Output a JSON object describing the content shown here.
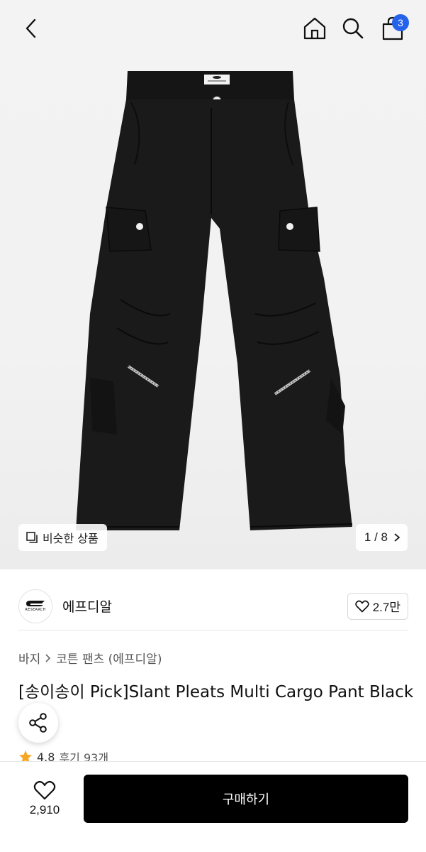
{
  "header": {
    "cart_count": "3"
  },
  "gallery": {
    "similar_label": "비슷한 상품",
    "pager": "1 / 8"
  },
  "brand": {
    "logo_text": "RESEARCH",
    "name": "에프디알",
    "like_count": "2.7만"
  },
  "product": {
    "breadcrumb": [
      "바지",
      "코튼 팬츠 (에프디알)"
    ],
    "title": "[송이송이 Pick]Slant Pleats Multi Cargo Pant Black",
    "rating": "4.8",
    "review": "후기 93개"
  },
  "bottom": {
    "wish_count": "2,910",
    "buy_label": "구매하기"
  },
  "colors": {
    "badge": "#2563eb",
    "buy_button": "#000000",
    "star": "#f5a623"
  }
}
